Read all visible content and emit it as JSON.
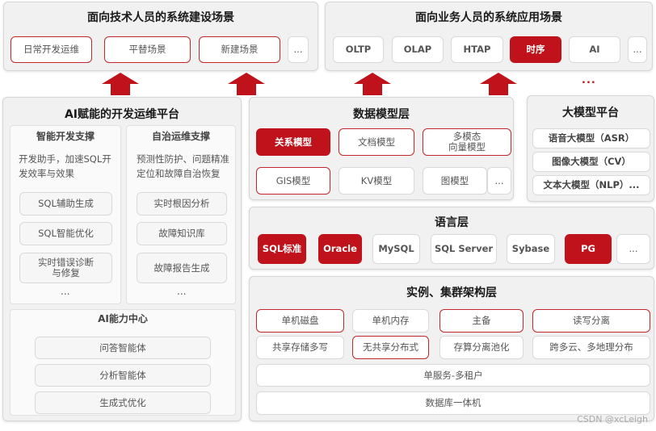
{
  "top_left": {
    "title": "面向技术人员的系统建设场景",
    "items": [
      "日常开发运维",
      "平替场景",
      "新建场景",
      "..."
    ]
  },
  "top_right": {
    "title": "面向业务人员的系统应用场景",
    "items": [
      "OLTP",
      "OLAP",
      "HTAP",
      "时序",
      "AI",
      "..."
    ],
    "more": "..."
  },
  "ai_platform": {
    "title": "AI赋能的开发运维平台",
    "dev": {
      "title": "智能开发支撑",
      "desc": "开发助手，加速SQL开发效率与效果",
      "items": [
        "SQL辅助生成",
        "SQL智能优化",
        "实时错误诊断\n与修复"
      ],
      "more": "..."
    },
    "ops": {
      "title": "自治运维支撑",
      "desc": "预测性防护、问题精准定位和故障自治恢复",
      "items": [
        "实时根因分析",
        "故障知识库",
        "故障报告生成"
      ],
      "more": "..."
    },
    "center": {
      "title": "AI能力中心",
      "items": [
        "问答智能体",
        "分析智能体",
        "生成式优化"
      ]
    }
  },
  "data_model": {
    "title": "数据模型层",
    "items": [
      "关系模型",
      "文档模型",
      "多模态\n向量模型",
      "GIS模型",
      "KV模型",
      "图模型",
      "..."
    ]
  },
  "llm": {
    "title": "大模型平台",
    "items": [
      "语音大模型（ASR）",
      "图像大模型（CV）",
      "文本大模型（NLP）..."
    ]
  },
  "language": {
    "title": "语言层",
    "items": [
      "SQL标准",
      "Oracle",
      "MySQL",
      "SQL Server",
      "Sybase",
      "PG",
      "..."
    ]
  },
  "instance": {
    "title": "实例、集群架构层",
    "items": [
      "单机磁盘",
      "单机内存",
      "主备",
      "读写分离",
      "共享存储多写",
      "无共享分布式",
      "存算分离池化",
      "跨多云、多地理分布",
      "单服务-多租户",
      "数据库一体机"
    ]
  },
  "watermark": "CSDN @xcLeigh",
  "colors": {
    "accent": "#c0121a",
    "panel": "#f1f1f1"
  }
}
